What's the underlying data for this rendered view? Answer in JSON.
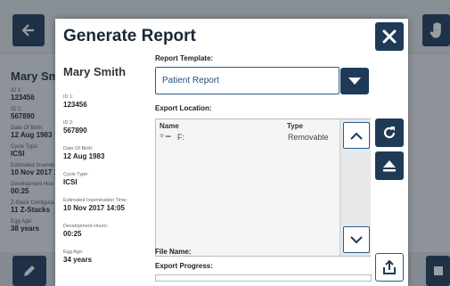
{
  "background": {
    "patient_name": "Mary Sm",
    "fields": [
      {
        "label": "ID 1:",
        "value": "123456"
      },
      {
        "label": "ID 2:",
        "value": "567890"
      },
      {
        "label": "Date Of Birth:",
        "value": "12 Aug 1983"
      },
      {
        "label": "Cycle Type:",
        "value": "ICSI"
      },
      {
        "label": "Estimated Insemin",
        "value": "10 Nov 2017 1"
      },
      {
        "label": "Development Hou",
        "value": "00:25"
      },
      {
        "label": "Z-Stack Configura",
        "value": "11 Z-Stacks"
      },
      {
        "label": "Egg Age:",
        "value": "38 years"
      }
    ]
  },
  "dialog": {
    "title": "Generate Report",
    "patient": {
      "name": "Mary Smith",
      "fields": [
        {
          "label": "ID 1:",
          "value": "123456"
        },
        {
          "label": "ID 2:",
          "value": "567890"
        },
        {
          "label": "Date Of Birth:",
          "value": "12 Aug 1983"
        },
        {
          "label": "Cycle Type:",
          "value": "ICSI"
        },
        {
          "label": "Estimated Insemination Time:",
          "value": "10 Nov 2017 14:05"
        },
        {
          "label": "Development Hours:",
          "value": "00:25"
        },
        {
          "label": "Egg Age:",
          "value": "34 years"
        }
      ]
    },
    "report_template": {
      "label": "Report Template:",
      "selected": "Patient Report"
    },
    "export_location": {
      "label": "Export Location:",
      "columns": [
        "Name",
        "Type"
      ],
      "rows": [
        {
          "name": "F:",
          "type": "Removable"
        }
      ]
    },
    "file_name_label": "File Name:",
    "export_progress": {
      "label": "Export Progress:",
      "fraction": 0.0
    }
  },
  "icons": {
    "close": "close-icon",
    "dropdown": "chevron-down-icon",
    "scroll_up": "chevron-up-icon",
    "scroll_down": "chevron-down-icon",
    "refresh": "refresh-icon",
    "eject": "eject-icon",
    "export": "export-icon",
    "back": "back-arrow-icon",
    "pencil": "pencil-icon",
    "hand": "hand-icon"
  },
  "colors": {
    "primary": "#1f3a56",
    "accent": "#2a5a8a"
  }
}
